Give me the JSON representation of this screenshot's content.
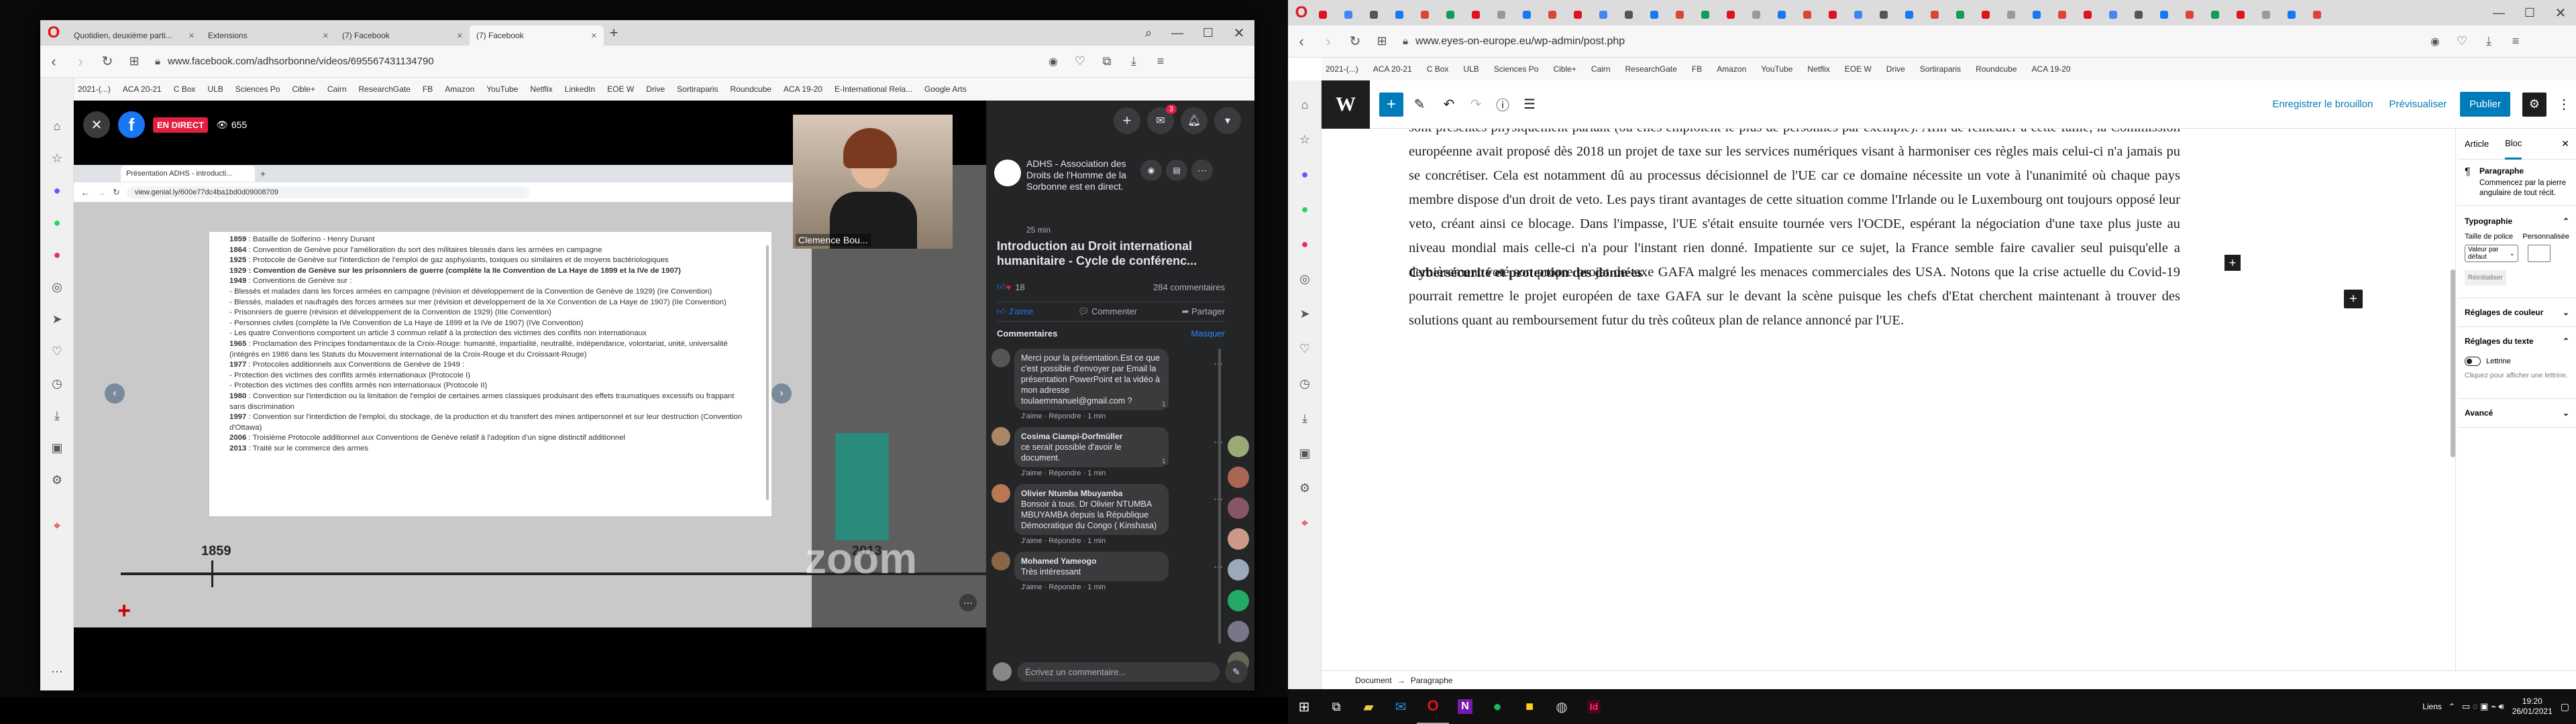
{
  "left_browser": {
    "tabs": [
      "Quotidien, deuxième parti...",
      "Extensions",
      "(7) Facebook",
      "(7) Facebook"
    ],
    "url": "www.facebook.com/adhsorbonne/videos/695567431134790",
    "bookmarks": [
      "2021-(...)",
      "ACA 20-21",
      "C Box",
      "ULB",
      "Sciences Po",
      "Cible+",
      "Cairn",
      "ResearchGate",
      "FB",
      "Amazon",
      "YouTube",
      "Netflix",
      "LinkedIn",
      "EOE W",
      "Drive",
      "Sortiraparis",
      "Roundcube",
      "ACA 19-20",
      "E-International Rela...",
      "Google Arts"
    ],
    "live_badge": "EN DIRECT",
    "viewers": "655",
    "inner_tab": "Présentation ADHS - introducti...",
    "inner_url": "view.genial.ly/600e77dc4ba1bd0d09008709",
    "timeline_years": [
      "1859",
      "2013"
    ],
    "slide_lines": [
      "1859 : Bataille de Solferino - Henry Dunant",
      "1864 : Convention de Genève pour l'amélioration du sort des militaires blessés dans les armées en campagne",
      "1925 : Protocole de Genève sur l'interdiction de l'emploi de gaz asphyxiants, toxiques ou similaires et de moyens bactériologiques",
      "1929 : Convention de Genève sur les prisonniers de guerre (complète la IIe Convention de La Haye de 1899 et la IVe de 1907)",
      "1949 : Conventions de Genève sur :",
      "- Blessés et malades dans les forces armées en campagne (révision et développement de la Convention de Genève de 1929) (Ire Convention)",
      "- Blessés, malades et naufragés des forces armées sur mer (révision et développement de la Xe Convention de La Haye de 1907) (IIe Convention)",
      "- Prisonniers de guerre (révision et développement de la Convention de 1929) (IIIe Convention)",
      "- Personnes civiles (complète la IVe Convention de La Haye de 1899 et la IVe de 1907) (IVe Convention)",
      "- Les quatre Conventions comportent un article 3 commun relatif à la protection des victimes des conflits non internationaux",
      "1965 : Proclamation des Principes fondamentaux de la Croix-Rouge: humanité, impartialité, neutralité, indépendance, volontariat, unité, universalité (intégrés en 1986 dans les Statuts du Mouvement international de la Croix-Rouge et du Croissant-Rouge)",
      "1977 : Protocoles additionnels aux Conventions de Genève de 1949 :",
      "- Protection des victimes des conflits armés internationaux (Protocole I)",
      "- Protection des victimes des conflits armés non internationaux (Protocole II)",
      "1980 : Convention sur l'interdiction ou la limitation de l'emploi de certaines armes classiques produisant des effets traumatiques excessifs ou frappant sans discrimination",
      "1997 : Convention sur l'interdiction de l'emploi, du stockage, de la production et du transfert des mines antipersonnel et sur leur destruction (Convention d'Ottawa)",
      "2006 : Troisième Protocole additionnel aux Conventions de Genève relatif à l'adoption d'un signe distinctif additionnel",
      "2013 : Traité sur le commerce des armes"
    ],
    "presenter_name": "Clemence Bou...",
    "zoom_logo": "zoom",
    "page_name": "ADHS - Association des Droits de l'Homme de la Sorbonne est en direct.",
    "time_ago": "25 min",
    "video_title": "Introduction au Droit international humanitaire - Cycle de conférenc...",
    "reactions_count": "18",
    "comments_count": "284 commentaires",
    "actions": {
      "like": "J'aime",
      "comment": "Commenter",
      "share": "Partager"
    },
    "comments_header": "Commentaires",
    "hide": "Masquer",
    "comments": [
      {
        "name": "",
        "text": "Merci pour la présentation.Est ce que c'est possible d'envoyer par Email la présentation PowerPoint et la vidéo à mon adresse toulaemmanuel@gmail.com ?",
        "meta": "J'aime · Répondre · 1 min",
        "react": "1"
      },
      {
        "name": "Cosima Ciampi-Dorfmüller",
        "text": "ce serait possible d'avoir le document.",
        "meta": "J'aime · Répondre · 1 min",
        "react": "1"
      },
      {
        "name": "Olivier Ntumba Mbuyamba",
        "text": "Bonsoir à tous. Dr Olivier NTUMBA MBUYAMBA depuis la République Démocratique du Congo ( Kinshasa)",
        "meta": "J'aime · Répondre · 1 min",
        "react": ""
      },
      {
        "name": "Mohamed Yameogo",
        "text": "Très intéressant",
        "meta": "J'aime · Répondre · 1 min",
        "react": ""
      }
    ],
    "comment_placeholder": "Écrivez un commentaire...",
    "notif_badge": "3"
  },
  "right_browser": {
    "url": "www.eyes-on-europe.eu/wp-admin/post.php",
    "bookmarks": [
      "2021-(...)",
      "ACA 20-21",
      "C Box",
      "ULB",
      "Sciences Po",
      "Cible+",
      "Cairn",
      "ResearchGate",
      "FB",
      "Amazon",
      "YouTube",
      "Netflix",
      "EOE W",
      "Drive",
      "Sortiraparis",
      "Roundcube",
      "ACA 19-20"
    ],
    "toolbar": {
      "save_draft": "Enregistrer le brouillon",
      "preview": "Prévisualiser",
      "publish": "Publier"
    },
    "paragraph": "sont présentés physiquement parlant (ou elles emploient le plus de personnes par exemple). Afin de remédier à cette faille, la Commission européenne avait proposé dès 2018 un projet de taxe sur les services numériques visant à harmoniser ces règles mais celui-ci n'a jamais pu se concrétiser. Cela est notamment dû au processus décisionnel de l'UE car ce domaine nécessite un vote à l'unanimité où chaque pays membre dispose d'un droit de veto. Les pays tirant avantages de cette situation comme l'Irlande ou le Luxembourg ont toujours opposé leur veto, créant ainsi ce blocage. Dans l'impasse, l'UE s'était ensuite tournée vers l'OCDE, espérant la négociation d'une taxe plus juste au niveau mondial mais celle-ci n'a pour l'instant rien donné. Impatiente sur ce sujet, la France semble faire cavalier seul puisqu'elle a dernièrement voté son propre projet de taxe GAFA malgré les menaces commerciales des USA. Notons que la crise actuelle du Covid-19 pourrait remettre le projet européen de taxe GAFA sur le devant la scène puisque les chefs d'Etat cherchent maintenant à trouver des solutions quant au remboursement futur du très coûteux plan de relance annoncé par l'UE.",
    "heading": "Cybersécurité et protection des données",
    "sidebar": {
      "tab_article": "Article",
      "tab_block": "Bloc",
      "block_name": "Paragraphe",
      "block_desc": "Commencez par la pierre angulaire de tout récit.",
      "typography": "Typographie",
      "font_size_label": "Taille de police",
      "custom_label": "Personnalisée",
      "font_size_value": "Valeur par défaut",
      "reset": "Réinitialiser",
      "color_settings": "Réglages de couleur",
      "text_settings": "Réglages du texte",
      "dropcap": "Lettrine",
      "dropcap_help": "Cliquez pour afficher une lettrine.",
      "advanced": "Avancé"
    },
    "breadcrumb": [
      "Document",
      "Paragraphe"
    ]
  },
  "taskbar": {
    "lang": "Liens",
    "time": "19:20",
    "date": "26/01/2021"
  }
}
